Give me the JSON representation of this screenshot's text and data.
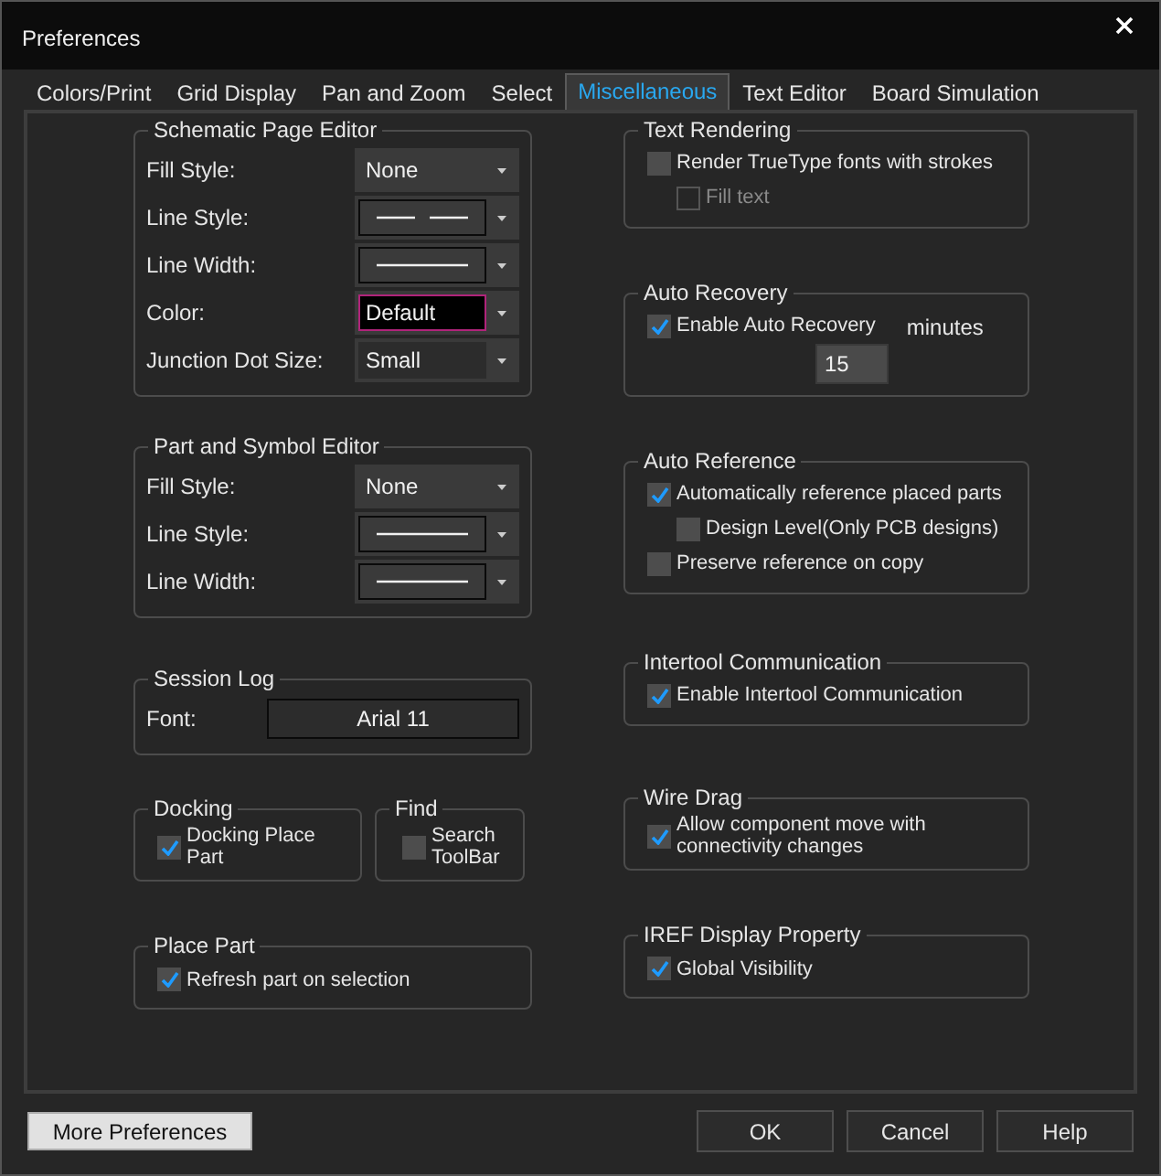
{
  "window": {
    "title": "Preferences"
  },
  "tabs": [
    {
      "label": "Colors/Print",
      "selected": false
    },
    {
      "label": "Grid Display",
      "selected": false
    },
    {
      "label": "Pan and Zoom",
      "selected": false
    },
    {
      "label": "Select",
      "selected": false
    },
    {
      "label": "Miscellaneous",
      "selected": true
    },
    {
      "label": "Text Editor",
      "selected": false
    },
    {
      "label": "Board Simulation",
      "selected": false
    }
  ],
  "left_groups": [
    {
      "kind": "fields",
      "title": "Schematic Page Editor",
      "fields": [
        {
          "label": "Fill Style:",
          "kind": "text",
          "value": "None",
          "framed": false,
          "focused": false
        },
        {
          "label": "Line Style:",
          "kind": "line",
          "dashed": true
        },
        {
          "label": "Line Width:",
          "kind": "line",
          "dashed": false
        },
        {
          "label": "Color:",
          "kind": "text",
          "value": "Default",
          "framed": true,
          "focused": true
        },
        {
          "label": "Junction Dot Size:",
          "kind": "text",
          "value": "Small",
          "framed": true,
          "focused": false
        }
      ]
    },
    {
      "kind": "fields",
      "title": "Part and Symbol Editor",
      "fields": [
        {
          "label": "Fill Style:",
          "kind": "text",
          "value": "None",
          "framed": false,
          "focused": false
        },
        {
          "label": "Line Style:",
          "kind": "line",
          "dashed": false
        },
        {
          "label": "Line Width:",
          "kind": "line",
          "dashed": false
        }
      ]
    },
    {
      "kind": "font",
      "title": "Session Log",
      "label": "Font:",
      "value": "Arial 11"
    },
    {
      "kind": "pair",
      "groups": [
        {
          "title": "Docking",
          "checks": [
            {
              "label": "Docking Place Part",
              "checked": true
            }
          ]
        },
        {
          "title": "Find",
          "checks": [
            {
              "label": "Search ToolBar",
              "checked": false
            }
          ]
        }
      ]
    },
    {
      "kind": "checks",
      "title": "Place Part",
      "checks": [
        {
          "label": "Refresh part on selection",
          "checked": true
        }
      ]
    }
  ],
  "right_groups": [
    {
      "kind": "checks",
      "title": "Text Rendering",
      "checks": [
        {
          "label": "Render TrueType fonts with strokes",
          "checked": false,
          "children": [
            {
              "label": "Fill text",
              "checked": false,
              "disabled": true
            }
          ]
        }
      ]
    },
    {
      "kind": "recovery",
      "title": "Auto Recovery",
      "check": {
        "label": "Enable Auto Recovery",
        "checked": true
      },
      "unit": "minutes",
      "value": "15"
    },
    {
      "kind": "checks",
      "title": "Auto Reference",
      "checks": [
        {
          "label": "Automatically reference placed parts",
          "checked": true,
          "children": [
            {
              "label": "Design Level(Only PCB designs)",
              "checked": false,
              "disabled": false
            }
          ]
        },
        {
          "label": "Preserve reference on copy",
          "checked": false
        }
      ]
    },
    {
      "kind": "checks",
      "title": "Intertool Communication",
      "checks": [
        {
          "label": "Enable Intertool Communication",
          "checked": true
        }
      ]
    },
    {
      "kind": "checks",
      "title": "Wire Drag",
      "checks": [
        {
          "label": "Allow component move with connectivity changes",
          "checked": true
        }
      ]
    },
    {
      "kind": "checks",
      "title": "IREF Display Property",
      "checks": [
        {
          "label": "Global Visibility",
          "checked": true
        }
      ]
    }
  ],
  "buttons": {
    "more": "More Preferences",
    "actions": [
      "OK",
      "Cancel",
      "Help"
    ]
  }
}
